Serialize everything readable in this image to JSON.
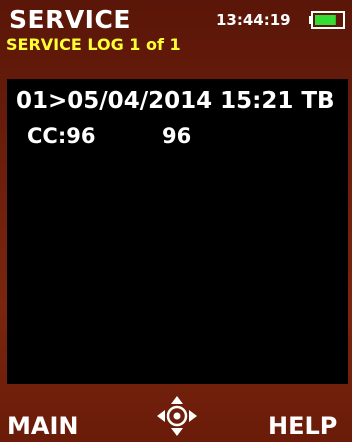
{
  "header": {
    "title": "SERVICE",
    "time": "13:44:19",
    "subtitle": "SERVICE LOG 1 of 1"
  },
  "battery": {
    "level": 0.8,
    "fill_color": "#33dd33"
  },
  "log": {
    "entry_line": "01>05/04/2014 15:21 TB",
    "cc_label": "CC:96",
    "cc_value": "96"
  },
  "footer": {
    "left_softkey": "MAIN",
    "right_softkey": "HELP",
    "center_icon": "dpad-navigation-icon"
  },
  "colors": {
    "background": "#6e1f0c",
    "panel": "#000000",
    "subtitle": "#ffff33",
    "text": "#ffffff"
  }
}
